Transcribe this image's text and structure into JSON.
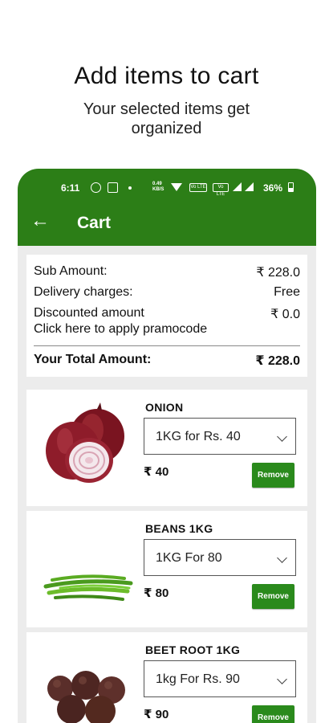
{
  "promo": {
    "title": "Add items to cart",
    "subtitle": "Your selected items get organized"
  },
  "status_bar": {
    "time": "6:11",
    "speed": "0.49\nKB/S",
    "volte1": "Vo LTE",
    "volte2": "Vo LTE",
    "battery": "36%",
    "icons": [
      "whatsapp-icon",
      "app-icon",
      "dot-icon",
      "wifi-icon",
      "signal-icon",
      "battery-icon"
    ]
  },
  "header": {
    "back_icon": "←",
    "title": "Cart",
    "color": "#2c7e17"
  },
  "summary": {
    "sub_amount_label": "Sub Amount:",
    "sub_amount_value": "₹ 228.0",
    "delivery_label": "Delivery charges:",
    "delivery_value": "Free",
    "discount_label": "Discounted amount",
    "discount_value": "₹ 0.0",
    "promo_link": "Click here to apply pramocode",
    "total_label": "Your Total Amount:",
    "total_value": "₹ 228.0"
  },
  "items": [
    {
      "name": "ONION",
      "option": "1KG for Rs. 40",
      "price": "₹ 40",
      "remove_label": "Remove",
      "image": "onion-image"
    },
    {
      "name": "BEANS 1KG",
      "option": "1KG For 80",
      "price": "₹ 80",
      "remove_label": "Remove",
      "image": "beans-image"
    },
    {
      "name": "BEET ROOT 1KG",
      "option": "1kg For  Rs. 90",
      "price": "₹ 90",
      "remove_label": "Remove",
      "image": "beetroot-image"
    }
  ],
  "colors": {
    "accent": "#2c7e17",
    "button": "#2a8a1c",
    "background": "#ececec"
  }
}
